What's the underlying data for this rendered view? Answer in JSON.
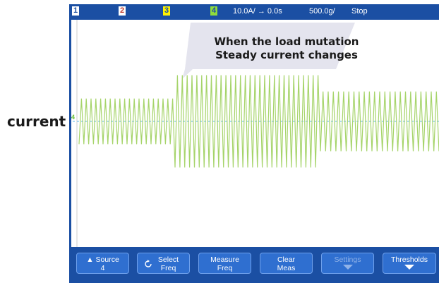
{
  "side_label": "current",
  "status_bar": {
    "ch1": "1",
    "ch2": "2",
    "ch3": "3",
    "ch4": "4",
    "trigger": "10.0A/ → 0.0s",
    "timebase": "500.0g/",
    "run_state": "Stop"
  },
  "channel_marker": "4",
  "callout": {
    "line1": "When the load mutation",
    "line2": "Steady current changes"
  },
  "softkeys": [
    {
      "line1": "▲ Source",
      "line2": "4",
      "enabled": true
    },
    {
      "line1": "Select",
      "line2": "Freq",
      "enabled": true,
      "icon": "cycle-icon"
    },
    {
      "line1": "Measure",
      "line2": "Freq",
      "enabled": true
    },
    {
      "line1": "Clear",
      "line2": "Meas",
      "enabled": true
    },
    {
      "line1": "Settings",
      "line2": "",
      "enabled": false,
      "icon": "arrow-down-icon"
    },
    {
      "line1": "Thresholds",
      "line2": "",
      "enabled": true,
      "icon": "arrow-down-icon"
    }
  ],
  "colors": {
    "frame": "#1b4fa3",
    "trace": "#a6d46a",
    "baseline": "#5bb8e8",
    "softkey": "#2f6fd0"
  },
  "waveform": {
    "segments": [
      {
        "cycles": 20,
        "amplitude_ratio": 0.42
      },
      {
        "cycles": 30,
        "amplitude_ratio": 0.85
      },
      {
        "cycles": 23,
        "amplitude_ratio": 0.55
      }
    ]
  }
}
